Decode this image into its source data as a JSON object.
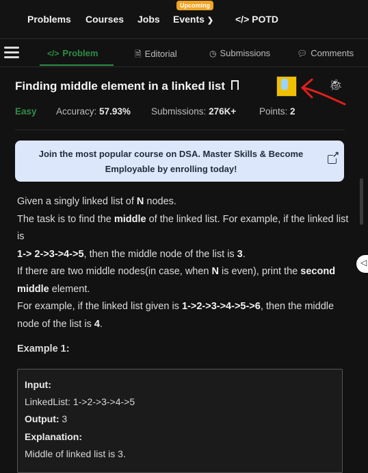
{
  "topnav": {
    "items": [
      "Problems",
      "Courses",
      "Jobs",
      "Events",
      "POTD"
    ],
    "badge": "Upcoming",
    "potd_icon": "</>"
  },
  "tabs": [
    {
      "label": "Problem",
      "icon": "</>",
      "active": true
    },
    {
      "label": "Editorial",
      "icon": "document-icon"
    },
    {
      "label": "Submissions",
      "icon": "clock-icon"
    },
    {
      "label": "Comments",
      "icon": "comment-icon"
    }
  ],
  "problem": {
    "title": "Finding middle element in a linked list",
    "difficulty": "Easy",
    "accuracy_label": "Accuracy:",
    "accuracy_value": "57.93%",
    "submissions_label": "Submissions:",
    "submissions_value": "276K+",
    "points_label": "Points:",
    "points_value": "2"
  },
  "promo": {
    "line1": "Join the most popular course on DSA. Master Skills & Become",
    "line2": "Employable by enrolling today!"
  },
  "description": {
    "p1a": "Given a singly linked list of ",
    "p1b": "N",
    "p1c": " nodes.",
    "p2a": "The task is to find the ",
    "p2b": "middle",
    "p2c": " of the linked list. For example, if the linked list is",
    "p3a": "1-> 2->3->4->5",
    "p3b": ", then the middle node of the list is ",
    "p3c": "3",
    "p3d": ".",
    "p4a": "If there are two middle nodes(in case, when ",
    "p4b": "N",
    "p4c": " is even), print the ",
    "p4d": "second middle",
    "p4e": " element.",
    "p5a": "For example, if the linked list given is ",
    "p5b": "1->2->3->4->5->6",
    "p5c": ", then the middle node of the list is ",
    "p5d": "4",
    "p5e": "."
  },
  "example": {
    "title": "Example 1:",
    "input_label": "Input:",
    "input_value": "LinkedList:  1->2->3->4->5",
    "output_label": "Output:",
    "output_value": "3",
    "explanation_label": "Explanation:",
    "explanation_value": "Middle  of  linked  list  is  3."
  },
  "colors": {
    "accent": "#2f8d46",
    "badge": "#f0a526",
    "annotation": "#e0201b"
  }
}
